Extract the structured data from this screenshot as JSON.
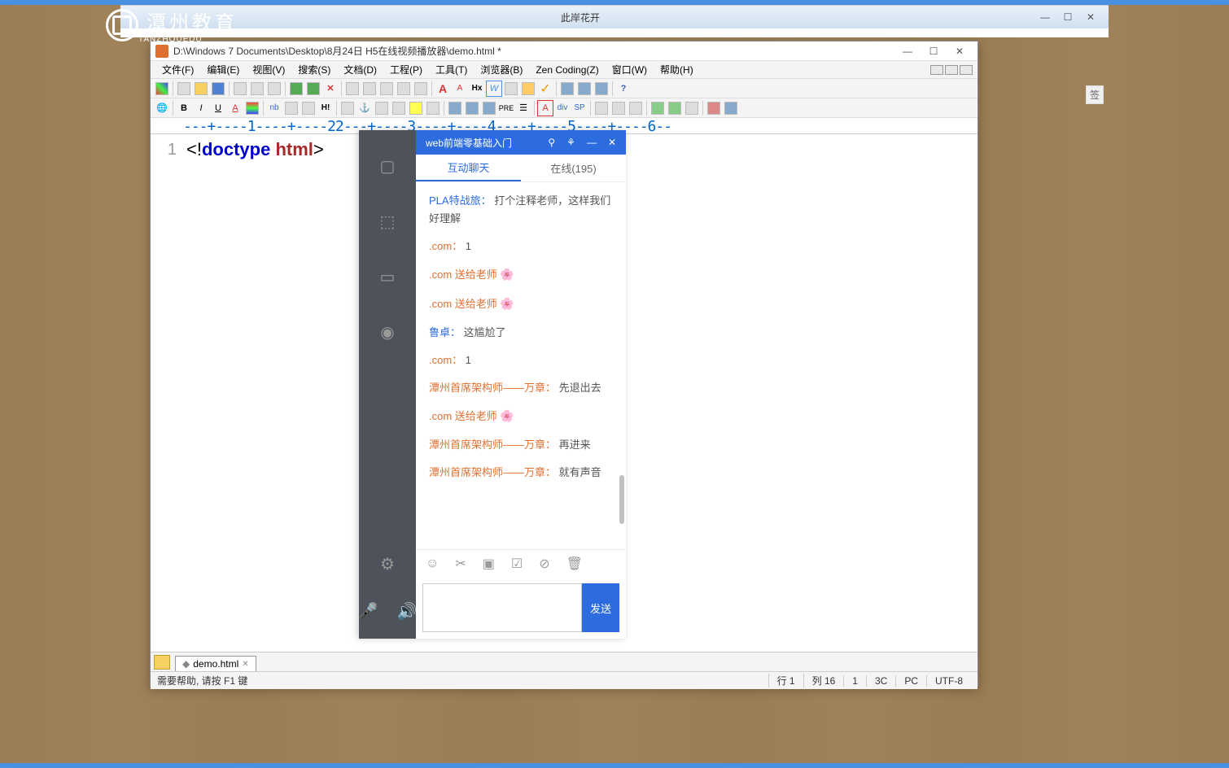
{
  "logo": {
    "main": "潭州教育",
    "sub": "TANZHOUEDU"
  },
  "chrome": {
    "title": "此岸花开",
    "min": "—",
    "max": "☐",
    "close": "✕"
  },
  "editor": {
    "title": "D:\\Windows 7 Documents\\Desktop\\8月24日 H5在线视频播放器\\demo.html *",
    "menu": [
      "文件(F)",
      "编辑(E)",
      "视图(V)",
      "搜索(S)",
      "文档(D)",
      "工程(P)",
      "工具(T)",
      "浏览器(B)",
      "Zen Coding(Z)",
      "窗口(W)",
      "帮助(H)"
    ],
    "ruler": "---+----1----+----22---+----3----+----4----+----5----+----6--",
    "line_no": "1",
    "code": {
      "p1": "<!",
      "kw": "doctype",
      "sp": " ",
      "tag": "html",
      "p2": ">"
    },
    "tab": {
      "dot": "◆",
      "name": "demo.html",
      "close": "✕"
    },
    "status": {
      "help": "需要帮助, 请按 F1 键",
      "row": "行 1",
      "col": "列 16",
      "num": "1",
      "sel": "3C",
      "os": "PC",
      "enc": "UTF-8"
    }
  },
  "chat": {
    "title": "web前端零基础入门",
    "hdr": {
      "pin": "⚲",
      "share": "⚘",
      "min": "—",
      "close": "✕"
    },
    "tabs": {
      "chat": "互动聊天",
      "online": "在线(195)"
    },
    "messages": [
      {
        "u": "PLA特战旅：",
        "c": "u",
        "t": "打个注释老师，这样我们好理解"
      },
      {
        "u": ".com：",
        "c": "u2",
        "t": "1"
      },
      {
        "u": ".com 送给老师",
        "c": "u2",
        "icon": "🌸"
      },
      {
        "u": ".com 送给老师",
        "c": "u2",
        "icon": "🌸"
      },
      {
        "u": "鲁卓：",
        "c": "u",
        "t": "这尴尬了"
      },
      {
        "u": ".com：",
        "c": "u2",
        "t": "1"
      },
      {
        "u": "潭州首席架构师——万章：",
        "c": "u2",
        "t": "先退出去"
      },
      {
        "u": ".com 送给老师",
        "c": "u2",
        "icon": "🌸"
      },
      {
        "u": "潭州首席架构师——万章：",
        "c": "u2",
        "t": "再进来"
      },
      {
        "u": "潭州首席架构师——万章：",
        "c": "u2",
        "t": "就有声音"
      }
    ],
    "tools": {
      "emoji": "☺",
      "cut": "✂",
      "img": "▣",
      "note": "☑",
      "block": "⊘",
      "del": "🗑"
    },
    "send": "发送"
  },
  "side_icons": {
    "screen": "▢",
    "bag": "⬚",
    "board": "▭",
    "camera": "◉",
    "gear": "⚙",
    "mic": "🎤",
    "vol": "🔊"
  },
  "bookmark": "签"
}
